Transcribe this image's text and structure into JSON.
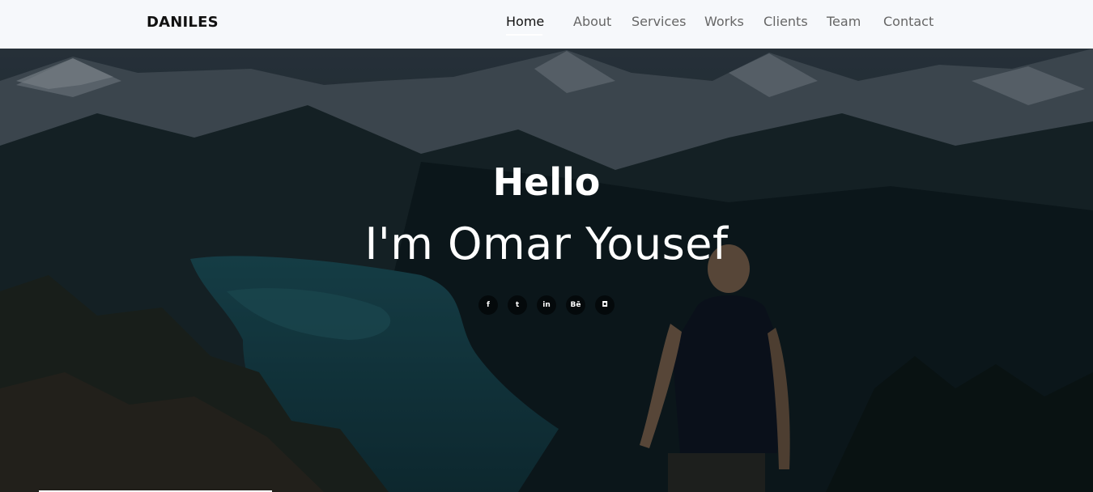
{
  "brand": "DANILES",
  "nav": {
    "items": [
      {
        "label": "Home",
        "active": true
      },
      {
        "label": "About"
      },
      {
        "label": "Services"
      },
      {
        "label": "Works"
      },
      {
        "label": "Clients"
      },
      {
        "label": "Team"
      },
      {
        "label": "Contact"
      }
    ]
  },
  "hero": {
    "greeting": "Hello",
    "name": "I'm Omar Yousef",
    "socials": [
      {
        "icon": "facebook-icon",
        "glyph": "f"
      },
      {
        "icon": "twitter-icon",
        "glyph": "t"
      },
      {
        "icon": "linkedin-icon",
        "glyph": "in"
      },
      {
        "icon": "behance-icon",
        "glyph": "Bē"
      },
      {
        "icon": "instagram-icon",
        "glyph": "◘"
      }
    ]
  },
  "colors": {
    "navbar_bg": "#f6f8fb",
    "nav_text": "#666666",
    "nav_active": "#111111",
    "hero_text": "#ffffff"
  }
}
